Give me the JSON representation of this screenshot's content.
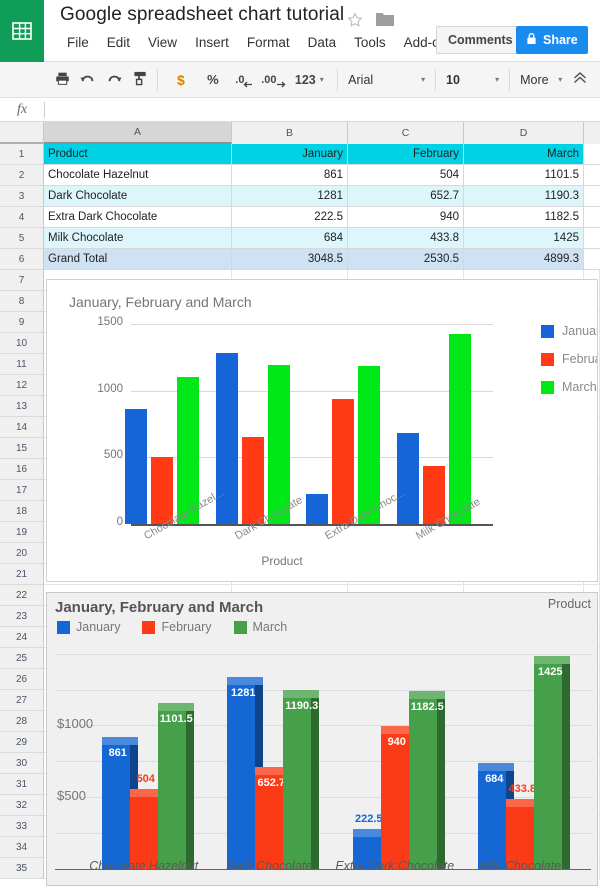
{
  "header": {
    "title": "Google spreadsheet chart tutorial",
    "star_icon": "star-icon",
    "folder_icon": "folder-icon",
    "menus": [
      "File",
      "Edit",
      "View",
      "Insert",
      "Format",
      "Data",
      "Tools",
      "Add-ons"
    ],
    "comments_label": "Comments",
    "share_label": "Share",
    "logo_icon": "sheets-grid-icon"
  },
  "toolbar": {
    "print_icon": "print-icon",
    "undo_icon": "undo-icon",
    "redo_icon": "redo-icon",
    "paint_format_icon": "paint-format-icon",
    "currency_label": "$",
    "percent_label": "%",
    "decrease_decimal_label": ".0",
    "increase_decimal_label": ".00",
    "number_format_label": "123",
    "font_name": "Arial",
    "font_size": "10",
    "more_label": "More",
    "collapse_icon": "double-chevron-up-icon"
  },
  "formula_bar": {
    "fx_label": "fx",
    "value": "",
    "placeholder": ""
  },
  "grid": {
    "columns": [
      "A",
      "B",
      "C",
      "D"
    ],
    "selected_column": "A",
    "rows": [
      1,
      2,
      3,
      4,
      5,
      6,
      7,
      8,
      9,
      10,
      11,
      12,
      13,
      14,
      15,
      16,
      17,
      18,
      19,
      20,
      21,
      22,
      23,
      24,
      25,
      26,
      27,
      28,
      29,
      30,
      31,
      32,
      33,
      34,
      35
    ],
    "table": {
      "header": [
        "Product",
        "January",
        "February",
        "March"
      ],
      "rows": [
        {
          "product": "Chocolate Hazelnut",
          "january": "861",
          "february": "504",
          "march": "1101.5"
        },
        {
          "product": "Dark Chocolate",
          "january": "1281",
          "february": "652.7",
          "march": "1190.3"
        },
        {
          "product": "Extra Dark Chocolate",
          "january": "222.5",
          "february": "940",
          "march": "1182.5"
        },
        {
          "product": "Milk Chocolate",
          "january": "684",
          "february": "433.8",
          "march": "1425"
        },
        {
          "product": "Grand Total",
          "january": "3048.5",
          "february": "2530.5",
          "march": "4899.3"
        }
      ]
    }
  },
  "colors": {
    "header_fill": "#00D2E6",
    "alt_fill": "#DCF6FB",
    "total_fill": "#CFE2F3",
    "brand_green": "#0F9D58",
    "share_blue": "#1a8cf0",
    "chart1_january": "#1565D8",
    "chart1_february": "#FF3A14",
    "chart1_march": "#00E818",
    "chart2_january": "#1567D3",
    "chart2_february": "#FB3B18",
    "chart2_march": "#45A049"
  },
  "chart_data": [
    {
      "id": "chart-1",
      "type": "bar",
      "title": "January, February and March",
      "xlabel": "Product",
      "ylabel": "",
      "ylim": [
        0,
        1500
      ],
      "yticks": [
        "0",
        "500",
        "1000",
        "1500"
      ],
      "grid": true,
      "legend_position": "right",
      "categories": [
        "Chocolate Hazel...",
        "Dark Chocolate",
        "Extra Dark Choc...",
        "Milk Chocolate"
      ],
      "series": [
        {
          "name": "January",
          "color": "#1565D8",
          "values": [
            861,
            1281,
            222.5,
            684
          ]
        },
        {
          "name": "February",
          "color": "#FF3A14",
          "values": [
            504,
            652.7,
            940,
            433.8
          ]
        },
        {
          "name": "March",
          "color": "#00E818",
          "values": [
            1101.5,
            1190.3,
            1182.5,
            1425
          ]
        }
      ]
    },
    {
      "id": "chart-2",
      "type": "bar",
      "title": "January, February and March",
      "corner_label": "Product",
      "xlabel": "",
      "ylabel": "",
      "ylim": [
        0,
        1560
      ],
      "yticks": [
        "$500",
        "$1000"
      ],
      "ytick_values": [
        500,
        1000
      ],
      "grid": true,
      "legend_position": "top-left",
      "data_labels": true,
      "three_d": true,
      "categories": [
        "Chocolate Hazelnut",
        "Dark Chocolate",
        "Extra Dark Chocolate",
        "Milk Chocolate"
      ],
      "series": [
        {
          "name": "January",
          "color": "#1567D3",
          "values": [
            861,
            1281,
            222.5,
            684
          ],
          "labels": [
            "861",
            "1281",
            "222.5",
            "684"
          ]
        },
        {
          "name": "February",
          "color": "#FB3B18",
          "values": [
            504,
            652.7,
            940,
            433.8
          ],
          "labels": [
            "504",
            "652.7",
            "940",
            "433.8"
          ]
        },
        {
          "name": "March",
          "color": "#45A049",
          "values": [
            1101.5,
            1190.3,
            1182.5,
            1425
          ],
          "labels": [
            "1101.5",
            "1190.3",
            "1182.5",
            "1425"
          ]
        }
      ]
    }
  ]
}
